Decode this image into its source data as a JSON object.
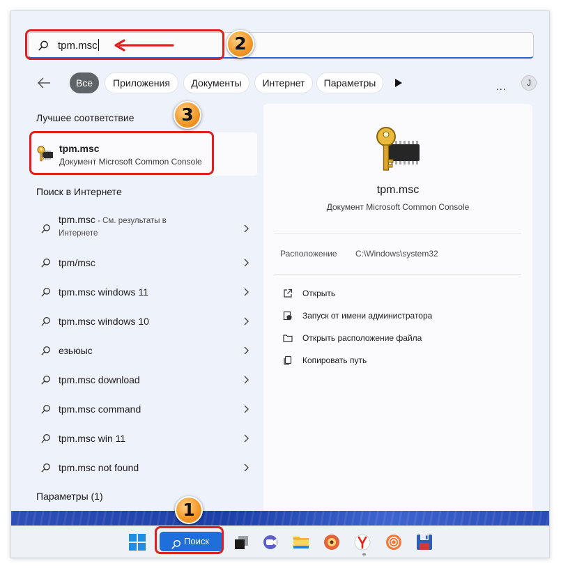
{
  "search": {
    "query": "tpm.msc"
  },
  "filters": {
    "back_label": "←",
    "chips": [
      "Все",
      "Приложения",
      "Документы",
      "Интернет",
      "Параметры"
    ],
    "more": "...",
    "avatar": "J"
  },
  "best_match": {
    "heading": "Лучшее соответствие",
    "title": "tpm.msc",
    "subtitle": "Документ Microsoft Common Console",
    "icon": "key-chip-icon"
  },
  "web": {
    "heading": "Поиск в Интернете",
    "first": {
      "label": "tpm.msc",
      "hint": " - См. результаты в",
      "sub": "Интернете"
    },
    "items": [
      "tpm/msc",
      "tpm.msc windows 11",
      "tpm.msc windows 10",
      "езьюыс",
      "tpm.msc download",
      "tpm.msc command",
      "tpm.msc win 11",
      "tpm.msc not found"
    ]
  },
  "settings_heading": "Параметры (1)",
  "detail": {
    "title": "tpm.msc",
    "subtitle": "Документ Microsoft Common Console",
    "location_label": "Расположение",
    "location_value": "C:\\Windows\\system32",
    "actions": [
      "Открыть",
      "Запуск от имени администратора",
      "Открыть расположение файла",
      "Копировать путь"
    ]
  },
  "taskbar": {
    "search_label": "Поиск",
    "apps": [
      "windows-start-icon",
      "task-view-icon",
      "video-call-icon",
      "file-explorer-icon",
      "media-player-icon",
      "yandex-browser-icon",
      "audio-app-icon",
      "floppy-save-icon"
    ]
  },
  "annotations": {
    "step1": "1",
    "step2": "2",
    "step3": "3"
  },
  "colors": {
    "accent": "#1e6fd9",
    "callout": "#e02020",
    "badge": "#f39a2b"
  }
}
